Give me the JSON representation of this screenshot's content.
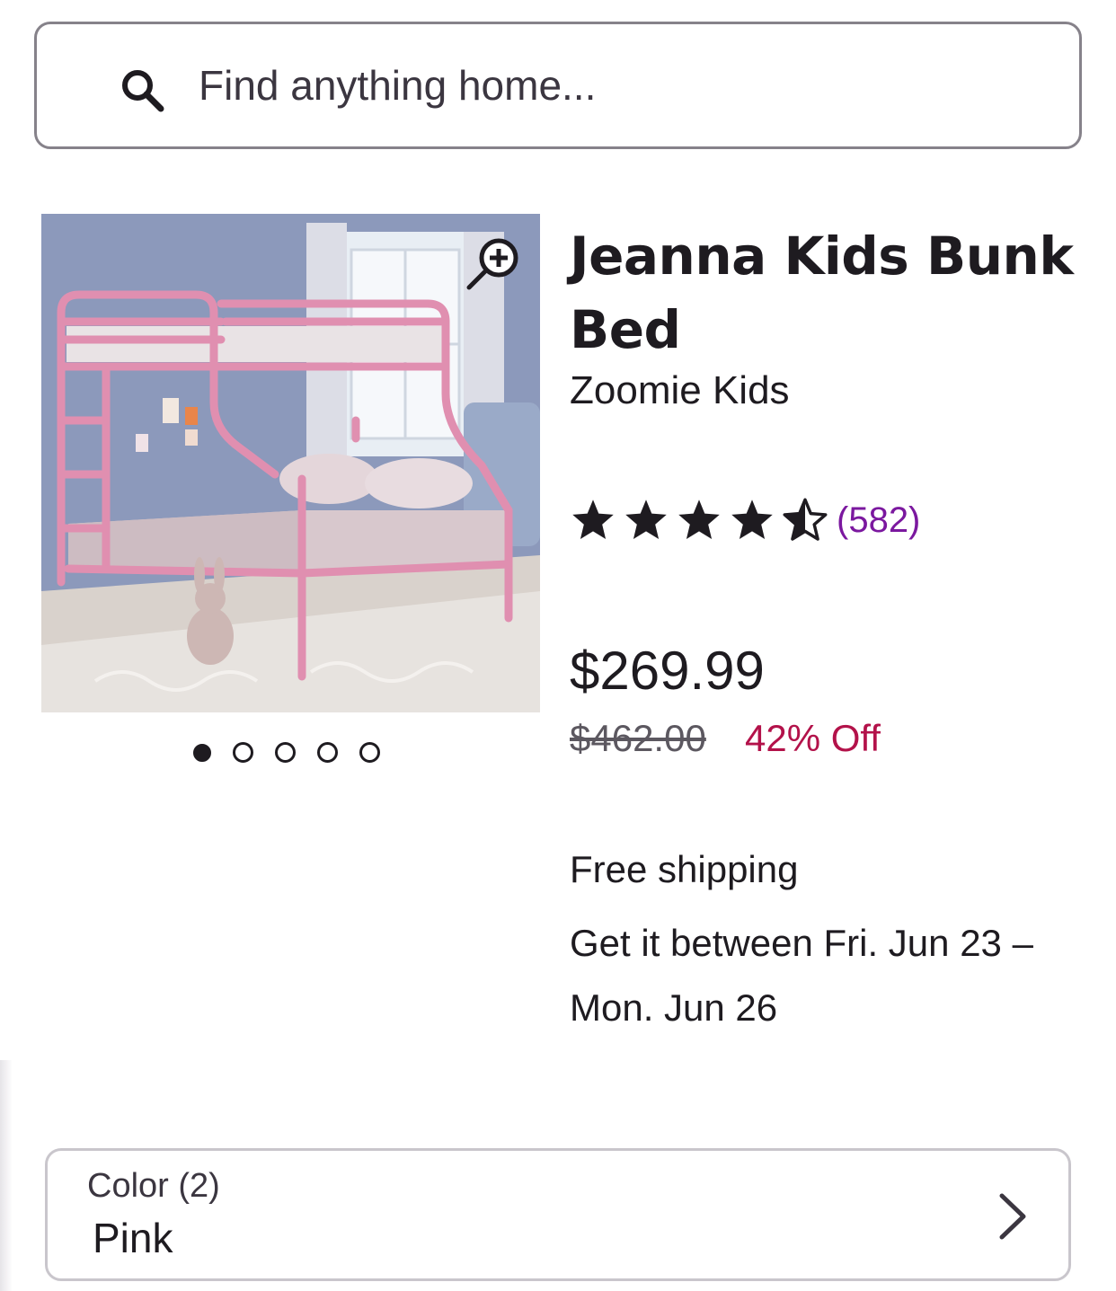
{
  "search": {
    "placeholder": "Find anything home...",
    "icon": "search-icon"
  },
  "product": {
    "title": "Jeanna Kids Bunk Bed",
    "brand": "Zoomie Kids",
    "rating": 4.5,
    "rating_max": 5,
    "review_count": "(582)",
    "price": "$269.99",
    "original_price": "$462.00",
    "discount": "42% Off",
    "shipping": "Free shipping",
    "delivery": "Get it between Fri. Jun 23 – Mon. Jun 26",
    "image": {
      "description_icon": "product-photo",
      "zoom_icon": "zoom-in-icon",
      "image_count": 5,
      "active_index": 0
    }
  },
  "option": {
    "label": "Color (2)",
    "value": "Pink",
    "icon": "chevron-right-icon"
  },
  "colors": {
    "text": "#1e1b20",
    "link": "#7b189f",
    "discount": "#b3124a",
    "border": "#86828a"
  }
}
